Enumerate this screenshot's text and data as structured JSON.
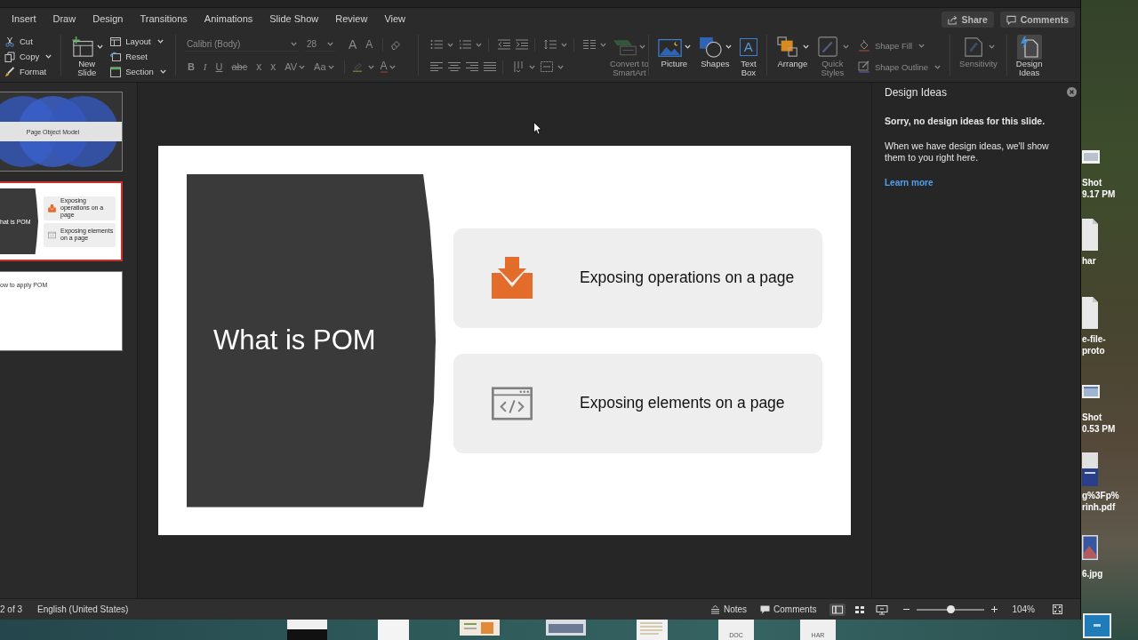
{
  "ribbon_tabs": [
    {
      "label": "Insert",
      "selected": false
    },
    {
      "label": "Draw",
      "selected": false
    },
    {
      "label": "Design",
      "selected": false
    },
    {
      "label": "Transitions",
      "selected": false
    },
    {
      "label": "Animations",
      "selected": false
    },
    {
      "label": "Slide Show",
      "selected": false
    },
    {
      "label": "Review",
      "selected": false
    },
    {
      "label": "View",
      "selected": false
    }
  ],
  "header_buttons": [
    {
      "kind": "share",
      "label": "Share"
    },
    {
      "kind": "comments",
      "label": "Comments"
    }
  ],
  "clipboard": [
    {
      "kind": "cut",
      "label": "Cut",
      "dropdown": false
    },
    {
      "kind": "copy",
      "label": "Copy",
      "dropdown": true
    },
    {
      "kind": "format",
      "label": "Format",
      "dropdown": false
    }
  ],
  "slides_group": {
    "new_slide": "New Slide",
    "items": [
      {
        "kind": "layout",
        "label": "Layout",
        "dropdown": true
      },
      {
        "kind": "reset",
        "label": "Reset",
        "dropdown": false
      },
      {
        "kind": "section",
        "label": "Section",
        "dropdown": true
      }
    ]
  },
  "font": {
    "disabled": true,
    "family": "Calibri (Body)",
    "size": "28",
    "size_buttons": [
      {
        "kind": "grow",
        "glyph": "A"
      },
      {
        "kind": "shrink",
        "glyph": "A"
      }
    ],
    "styles": [
      {
        "kind": "bold",
        "glyph": "B",
        "dropdown": false
      },
      {
        "kind": "italic",
        "glyph": "I",
        "dropdown": false
      },
      {
        "kind": "underline",
        "glyph": "U",
        "dropdown": false
      },
      {
        "kind": "strikethrough",
        "glyph": "abc",
        "dropdown": false
      },
      {
        "kind": "superscript",
        "glyph": "x",
        "dropdown": false
      },
      {
        "kind": "subscript",
        "glyph": "x",
        "dropdown": false
      },
      {
        "kind": "spacing",
        "glyph": "AV",
        "dropdown": true
      },
      {
        "kind": "case",
        "glyph": "Aa",
        "dropdown": true
      }
    ],
    "color_glyph": "A"
  },
  "paragraph": {
    "disabled": true,
    "smartart": "Convert to SmartArt"
  },
  "insert": [
    {
      "kind": "picture",
      "label": "Picture"
    },
    {
      "kind": "shapes",
      "label": "Shapes"
    },
    {
      "kind": "textbox",
      "label": "Text Box",
      "glyph": "A"
    }
  ],
  "drawing": {
    "arrange": {
      "label": "Arrange",
      "disabled": false
    },
    "quick_styles": {
      "label": "Quick Styles",
      "disabled": true
    },
    "format": [
      {
        "kind": "fill",
        "label": "Shape Fill",
        "disabled": true
      },
      {
        "kind": "outline",
        "label": "Shape Outline",
        "disabled": true
      }
    ]
  },
  "sensitivity": {
    "label": "Sensitivity",
    "disabled": true
  },
  "design_ideas_button": {
    "label": "Design Ideas",
    "selected": true
  },
  "thumbnails": [
    {
      "kind": "title",
      "title": "Page Object Model",
      "selected": false
    },
    {
      "kind": "cards",
      "title": "hat is POM",
      "items": [
        {
          "kind": "download",
          "text": "Exposing operations on a page"
        },
        {
          "kind": "code",
          "text": "Exposing elements on a page"
        }
      ],
      "selected": true
    },
    {
      "kind": "heading",
      "title": "ow to apply POM",
      "selected": false
    }
  ],
  "slide": {
    "title": "What is POM",
    "cards": [
      {
        "kind": "download",
        "text": "Exposing operations on a page"
      },
      {
        "kind": "code",
        "text": "Exposing elements on a page"
      }
    ]
  },
  "design_ideas": {
    "title": "Design Ideas",
    "message": "Sorry, no design ideas for this slide.",
    "body": "When we have design ideas, we'll show them to you right here.",
    "link": "Learn more"
  },
  "status_bar": {
    "slide_position": "2 of 3",
    "language": "English (United States)",
    "notes": "Notes",
    "comments": "Comments",
    "views": [
      {
        "kind": "normal",
        "selected": true
      },
      {
        "kind": "sorter",
        "selected": false
      },
      {
        "kind": "reading",
        "selected": false
      }
    ],
    "zoom": {
      "level": 0.5,
      "reading": "104%"
    }
  },
  "desktop_files": [
    {
      "kind": "image",
      "lines": [
        "Shot",
        "9.17 PM"
      ]
    },
    {
      "kind": "document",
      "lines": [
        "har"
      ]
    },
    {
      "kind": "document",
      "lines": [
        "e-file-",
        "proto"
      ]
    },
    {
      "kind": "screenshot",
      "lines": [
        "Shot",
        "0.53 PM"
      ]
    },
    {
      "kind": "pdf",
      "lines": [
        "g%3Fp%",
        "rinh.pdf"
      ]
    },
    {
      "kind": "photo",
      "lines": [
        "6.jpg"
      ]
    },
    {
      "kind": "folder"
    }
  ],
  "dock": [
    {
      "kind": "page"
    },
    {
      "kind": "blank"
    },
    {
      "kind": "chart"
    },
    {
      "kind": "window"
    },
    {
      "kind": "list"
    },
    {
      "kind": "file",
      "label": "DOC"
    },
    {
      "kind": "file",
      "label": "HAR"
    }
  ]
}
